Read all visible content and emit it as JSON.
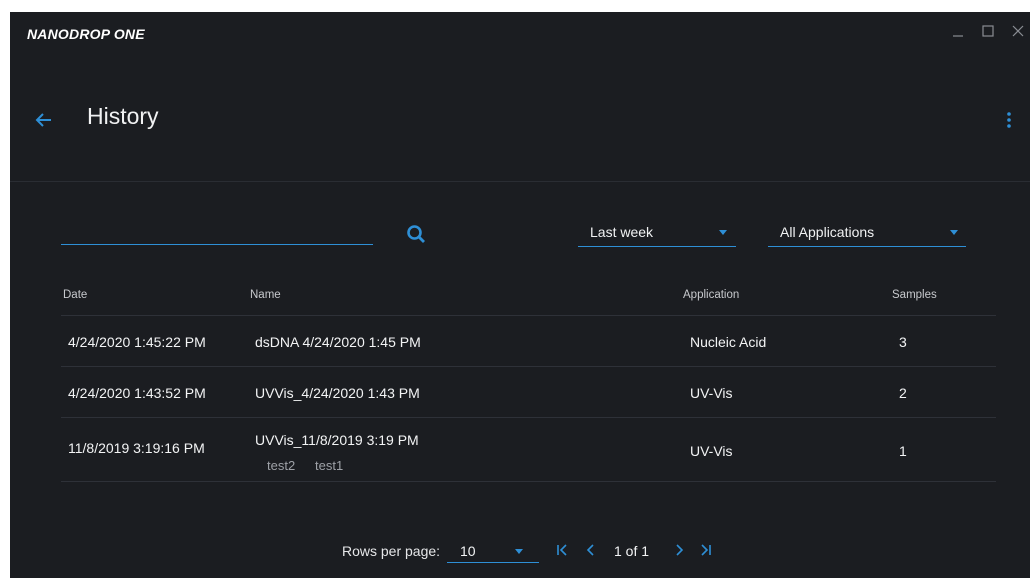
{
  "app": {
    "title": "NANODROP ONE"
  },
  "header": {
    "title": "History"
  },
  "search": {
    "value": "",
    "placeholder": ""
  },
  "filters": {
    "date_range": "Last week",
    "application": "All Applications"
  },
  "table": {
    "columns": [
      "Date",
      "Name",
      "Application",
      "Samples"
    ],
    "rows": [
      {
        "date": "4/24/2020 1:45:22 PM",
        "name": "dsDNA 4/24/2020 1:45 PM",
        "application": "Nucleic Acid",
        "samples": "3",
        "tags": []
      },
      {
        "date": "4/24/2020 1:43:52 PM",
        "name": "UVVis_4/24/2020 1:43 PM",
        "application": "UV-Vis",
        "samples": "2",
        "tags": []
      },
      {
        "date": "11/8/2019 3:19:16 PM",
        "name": "UVVis_11/8/2019 3:19 PM",
        "application": "UV-Vis",
        "samples": "1",
        "tags": [
          "test2",
          "test1"
        ]
      }
    ]
  },
  "pagination": {
    "rows_label": "Rows per page:",
    "rows_value": "10",
    "page_info": "1 of 1"
  },
  "colors": {
    "background": "#1b1d21",
    "accent": "#2e8fd6",
    "text": "#f3f4f5",
    "muted": "#9ea1a7"
  },
  "icons": [
    "minimize-icon",
    "maximize-icon",
    "close-icon",
    "back-arrow-icon",
    "more-vertical-icon",
    "search-icon",
    "first-page-icon",
    "prev-page-icon",
    "next-page-icon",
    "last-page-icon"
  ]
}
